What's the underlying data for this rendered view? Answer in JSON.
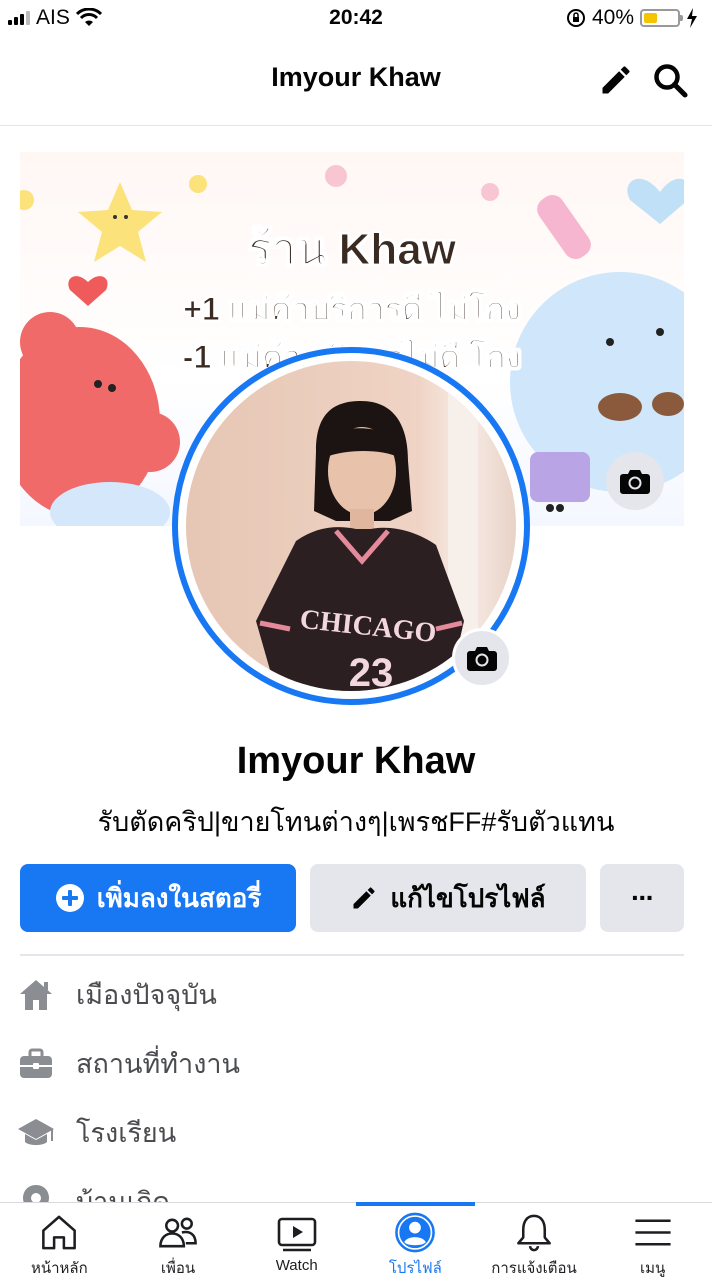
{
  "status_bar": {
    "carrier": "AIS",
    "time": "20:42",
    "battery_percent": "40%",
    "battery_level": 0.4
  },
  "header": {
    "title": "Imyour Khaw"
  },
  "cover": {
    "shop_name": "ร้าน Khaw",
    "line_1": "+1 แม่ค้าบริการดี ไม่โกง",
    "line_2": "-1 แม่ค้า บริการไม่ดี โกง"
  },
  "avatar": {
    "shirt_text": "CHICAGO",
    "shirt_number": "23"
  },
  "profile": {
    "name": "Imyour Khaw",
    "bio": "รับตัดคริป|ขายโทนต่างๆ|เพรชFF#รับตัวแทน"
  },
  "actions": {
    "add_story_label": "เพิ่มลงในสตอรี่",
    "edit_profile_label": "แก้ไขโปรไฟล์",
    "more_label": "···"
  },
  "info": [
    {
      "icon": "home-icon",
      "label": "เมืองปัจจุบัน"
    },
    {
      "icon": "briefcase-icon",
      "label": "สถานที่ทำงาน"
    },
    {
      "icon": "graduation-cap-icon",
      "label": "โรงเรียน"
    },
    {
      "icon": "location-pin-icon",
      "label": "บ้านเกิด"
    }
  ],
  "tabs": [
    {
      "icon": "home-icon",
      "label": "หน้าหลัก",
      "active": false
    },
    {
      "icon": "friends-icon",
      "label": "เพื่อน",
      "active": false
    },
    {
      "icon": "watch-icon",
      "label": "Watch",
      "active": false
    },
    {
      "icon": "profile-icon",
      "label": "โปรไฟล์",
      "active": true
    },
    {
      "icon": "bell-icon",
      "label": "การแจ้งเตือน",
      "active": false
    },
    {
      "icon": "menu-icon",
      "label": "เมนู",
      "active": false
    }
  ],
  "colors": {
    "accent": "#1877f2",
    "button_gray": "#e4e6eb",
    "text_secondary": "#4b4c4f"
  }
}
